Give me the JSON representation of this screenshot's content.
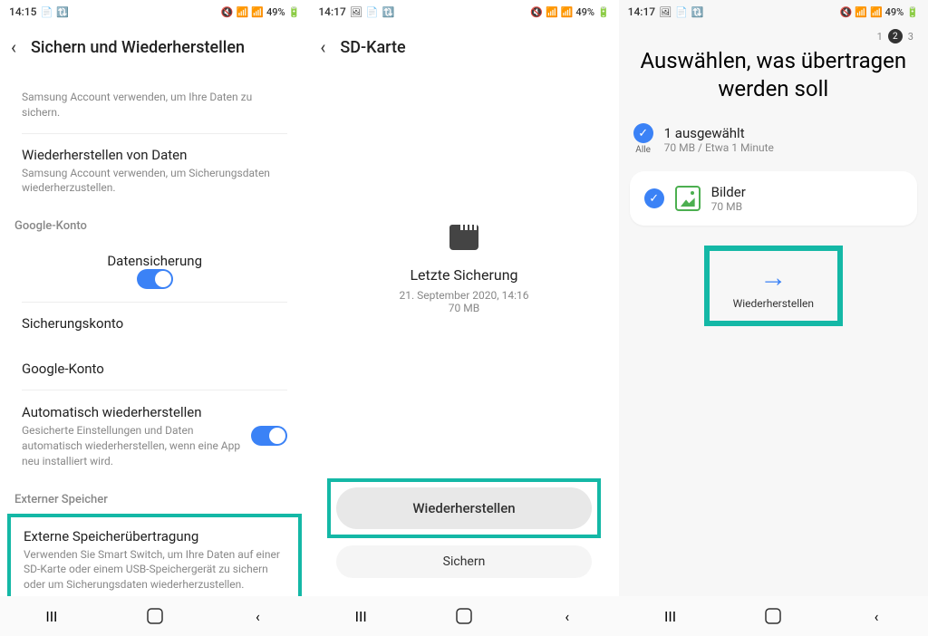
{
  "status": {
    "time1": "14:15",
    "time2": "14:17",
    "time3": "14:17",
    "battery": "49%",
    "signal": "📶"
  },
  "screen1": {
    "title": "Sichern und Wiederherstellen",
    "samsung_backup_desc": "Samsung Account verwenden, um Ihre Daten zu sichern.",
    "restore_title": "Wiederherstellen von Daten",
    "restore_desc": "Samsung Account verwenden, um Sicherungsdaten wiederherzustellen.",
    "google_section": "Google-Konto",
    "data_backup": "Datensicherung",
    "backup_account": "Sicherungskonto",
    "google_account": "Google-Konto",
    "auto_restore_title": "Automatisch wiederherstellen",
    "auto_restore_desc": "Gesicherte Einstellungen und Daten automatisch wiederherstellen, wenn eine App neu installiert wird.",
    "external_section": "Externer Speicher",
    "external_title": "Externe Speicherübertragung",
    "external_desc": "Verwenden Sie Smart Switch, um Ihre Daten auf einer SD-Karte oder einem USB-Speichergerät zu sichern oder um Sicherungsdaten wiederherzustellen."
  },
  "screen2": {
    "title": "SD-Karte",
    "last_backup": "Letzte Sicherung",
    "backup_date": "21. September 2020, 14:16",
    "backup_size": "70 MB",
    "restore_btn": "Wiederherstellen",
    "backup_btn": "Sichern"
  },
  "screen3": {
    "step1": "1",
    "step2": "2",
    "step3": "3",
    "title": "Auswählen, was übertragen werden soll",
    "all_label": "Alle",
    "selected_count": "1 ausgewählt",
    "selected_info": "70 MB / Etwa 1 Minute",
    "images_label": "Bilder",
    "images_size": "70 MB",
    "restore_btn": "Wiederherstellen"
  }
}
